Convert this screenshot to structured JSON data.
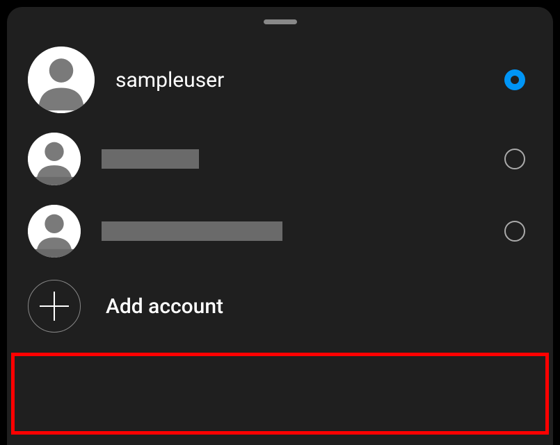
{
  "accounts": [
    {
      "username": "sampleuser",
      "selected": true,
      "redacted": false
    },
    {
      "username": "",
      "selected": false,
      "redacted": true
    },
    {
      "username": "",
      "selected": false,
      "redacted": true
    }
  ],
  "add_account_label": "Add account",
  "colors": {
    "background": "#1f1f1f",
    "accent": "#0095f6",
    "highlight": "#ff0000"
  }
}
